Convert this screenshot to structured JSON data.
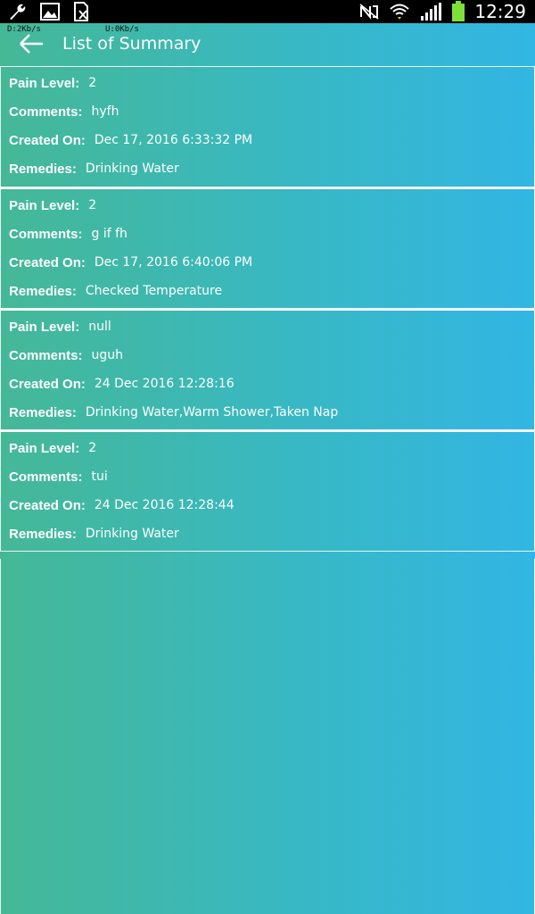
{
  "status_bar": {
    "time": "12:29",
    "icons": [
      "wrench-icon",
      "image-icon",
      "sim-icon"
    ],
    "right_icons": [
      "nfc-icon",
      "wifi-icon",
      "signal-icon",
      "battery-icon"
    ]
  },
  "net_speed": {
    "download": "D:2Kb/s",
    "upload": "U:0Kb/s"
  },
  "toolbar": {
    "title": "List of Summary"
  },
  "labels": {
    "pain_level": "Pain Level:",
    "comments": "Comments:",
    "created_on": "Created On:",
    "remedies": "Remedies:"
  },
  "entries": [
    {
      "pain_level": "2",
      "comments": "hyfh",
      "created_on": "Dec 17, 2016 6:33:32 PM",
      "remedies": "Drinking Water"
    },
    {
      "pain_level": "2",
      "comments": "g if fh",
      "created_on": "Dec 17, 2016 6:40:06 PM",
      "remedies": "Checked Temperature"
    },
    {
      "pain_level": "null",
      "comments": "uguh",
      "created_on": "24 Dec 2016 12:28:16",
      "remedies": "Drinking Water,Warm Shower,Taken Nap"
    },
    {
      "pain_level": "2",
      "comments": "tui",
      "created_on": "24 Dec 2016 12:28:44",
      "remedies": "Drinking Water"
    }
  ]
}
